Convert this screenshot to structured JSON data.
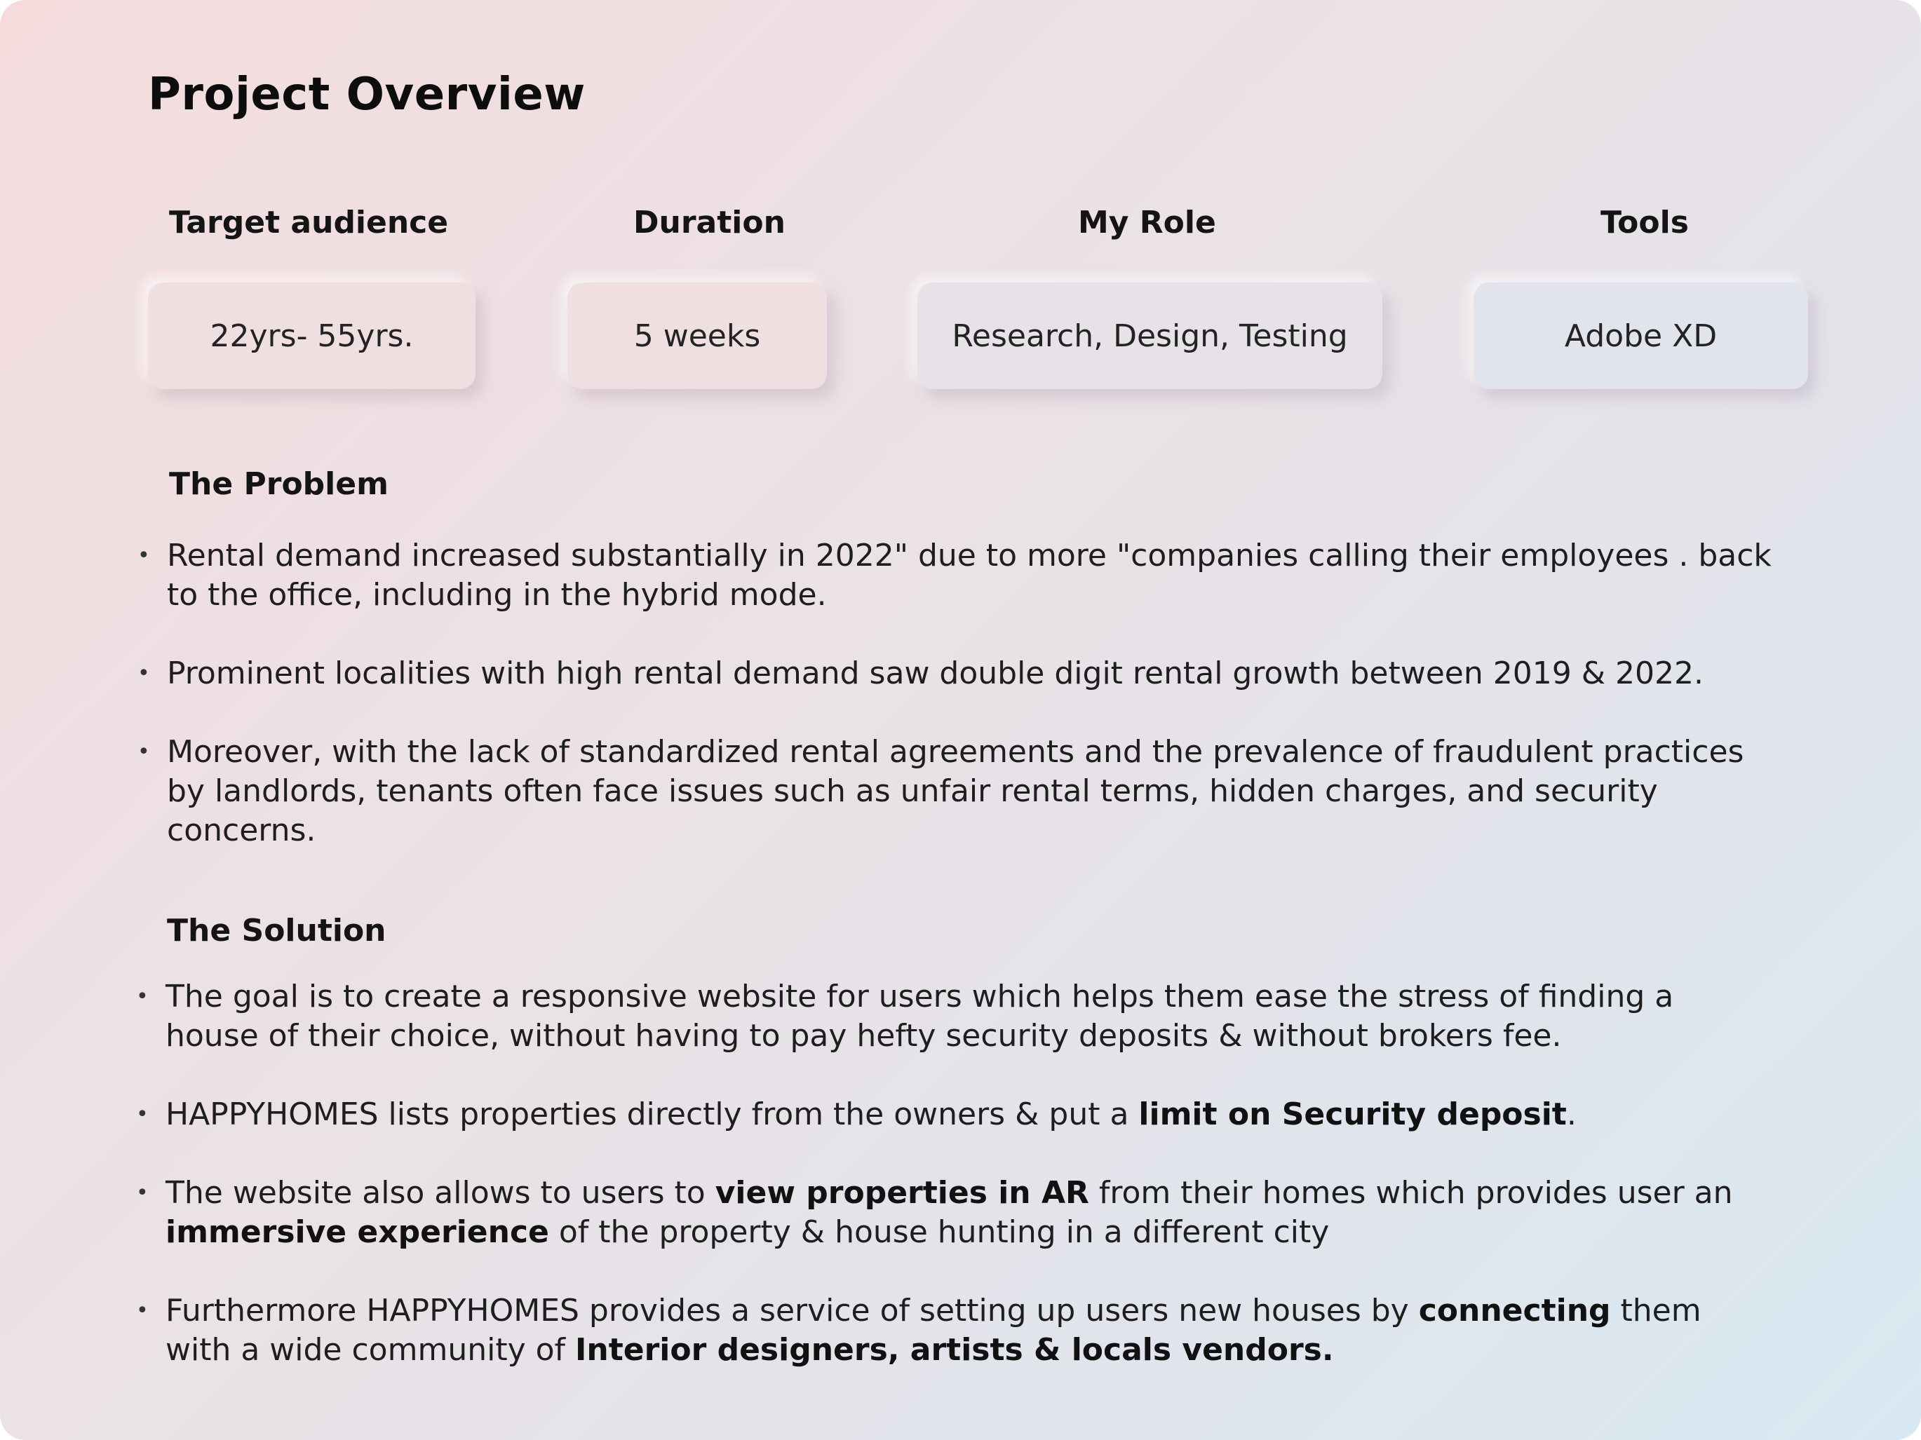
{
  "page": {
    "title": "Project Overview"
  },
  "meta": [
    {
      "label": "Target audience",
      "value": "22yrs- 55yrs."
    },
    {
      "label": "Duration",
      "value": "5 weeks"
    },
    {
      "label": "My Role",
      "value": "Research, Design, Testing"
    },
    {
      "label": "Tools",
      "value": "Adobe XD"
    }
  ],
  "problem": {
    "title": "The Problem",
    "items": [
      "Rental demand increased substantially in 2022\" due to more \"companies calling their employees  . back to the office, including in the hybrid mode.",
      "Prominent localities with high rental demand saw double digit rental growth between 2019 & 2022.",
      "Moreover, with the lack of standardized rental agreements and the prevalence of fraudulent practices by landlords, tenants often face issues such as unfair rental terms, hidden charges, and security concerns."
    ]
  },
  "solution": {
    "title": "The Solution",
    "item1": "The goal is to create a responsive website for users  which helps them ease the stress of finding a house of their choice, without having to pay hefty security deposits & without brokers fee.",
    "item2": {
      "a": "HAPPYHOMES lists properties directly from the owners & put a ",
      "b": "limit on Security deposit",
      "c": "."
    },
    "item3": {
      "a": "The website also allows to users to ",
      "b": "view properties in AR",
      "c": " from their homes which provides user an ",
      "d": "immersive experience",
      "e": " of the property & house hunting in a different city"
    },
    "item4": {
      "a": "Furthermore HAPPYHOMES provides a service of setting up users new houses by ",
      "b": "connecting",
      "c": " them with a wide community of ",
      "d": "Interior designers, artists & locals vendors."
    }
  }
}
